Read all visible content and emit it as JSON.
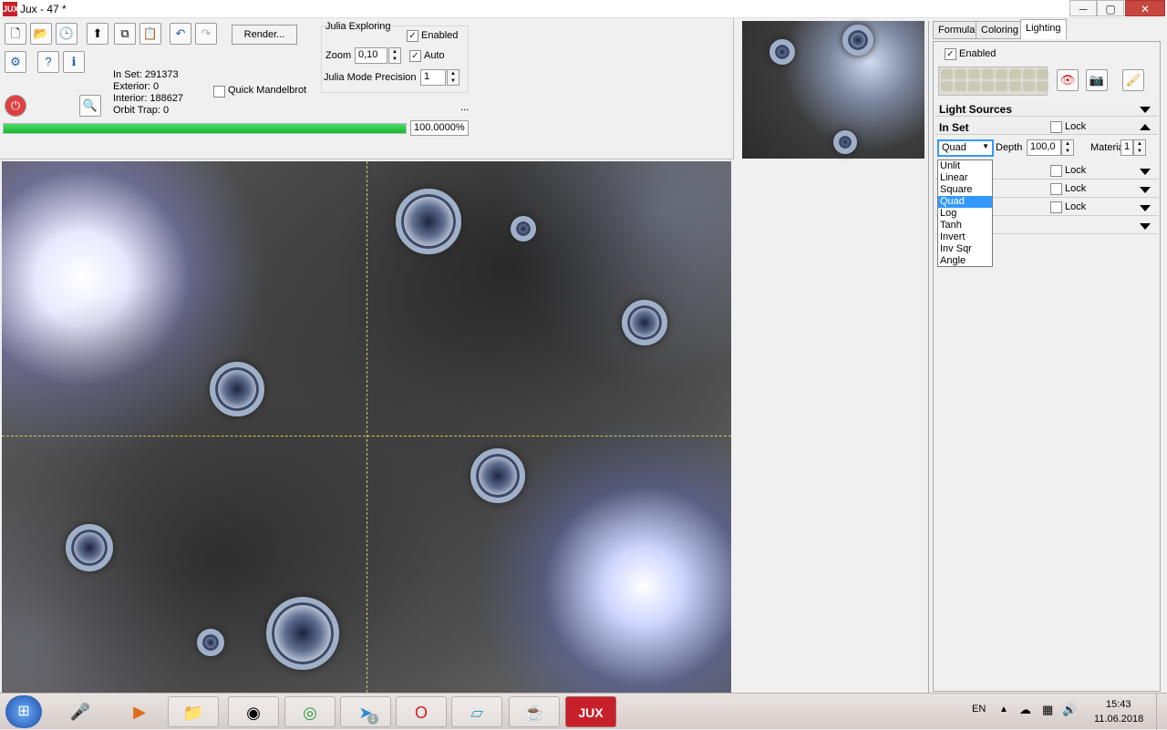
{
  "window": {
    "title": "Jux - 47 *",
    "logo": "JUX",
    "minimize": "─",
    "maximize": "▢",
    "close": "✕"
  },
  "toolbar": {
    "icons": [
      "new-file-icon",
      "open-folder-icon",
      "recent-file-icon",
      "export-icon",
      "copy-icon",
      "paste-icon",
      "undo-icon",
      "redo-icon"
    ],
    "render_label": "Render..."
  },
  "stats": {
    "in_set": "In Set: 291373",
    "exterior": "Exterior: 0",
    "interior": "Interior: 188627",
    "orbit_trap": "Orbit Trap: 0"
  },
  "quick_mandelbrot": {
    "label": "Quick Mandelbrot",
    "checked": false
  },
  "julia": {
    "group_label": "Julia Exploring",
    "enabled_label": "Enabled",
    "enabled": true,
    "zoom_label": "Zoom",
    "zoom_value": "0,10",
    "auto_label": "Auto",
    "auto": true,
    "precision_label": "Julia Mode Precision",
    "precision_value": "1",
    "ellipsis": "..."
  },
  "progress": {
    "percent": 100,
    "text": "100.0000%"
  },
  "panel": {
    "tabs": [
      "Formula",
      "Coloring",
      "Lighting"
    ],
    "active_tab": "Lighting",
    "enabled_label": "Enabled",
    "light_sources_label": "Light Sources",
    "in_set_label": "In Set",
    "lock_label": "Lock",
    "mode_value": "Quad",
    "depth_label": "Depth",
    "depth_value": "100,0",
    "material_label": "Material",
    "material_value": "1",
    "dropdown_options": [
      "Unlit",
      "Linear",
      "Square",
      "Quad",
      "Log",
      "Tanh",
      "Invert",
      "Inv Sqr",
      "Angle"
    ],
    "selected_option": "Quad",
    "extra_rows": [
      {
        "lock_label": "Lock"
      },
      {
        "lock_label": "Lock"
      },
      {
        "lock_label": "Lock"
      }
    ]
  },
  "taskbar": {
    "language": "EN",
    "time": "15:43",
    "date": "11.06.2018",
    "telegram_badge": "1"
  },
  "colors": {
    "progress": "#14b531",
    "selection": "#3399ff",
    "close_button": "#c7463e"
  }
}
